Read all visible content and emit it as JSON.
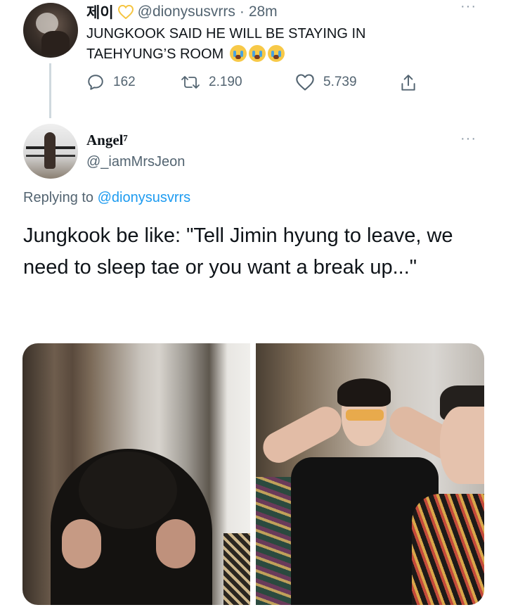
{
  "tweet": {
    "display_name": "제이",
    "handle": "@dionysusvrrs",
    "separator": "·",
    "time": "28m",
    "text": "JUNGKOOK SAID HE WILL BE STAYING IN TAEHYUNG’S ROOM",
    "emoji_count": 3,
    "emoji": "loudly-crying-face",
    "more_label": "···",
    "actions": {
      "reply_count": "162",
      "retweet_count": "2.190",
      "like_count": "5.739"
    },
    "badge_color": "#f5c542"
  },
  "reply": {
    "display_name": "Angel⁷",
    "handle": "@_iamMrsJeon",
    "more_label": "···",
    "replying_prefix": "Replying to",
    "replying_handle": "@dionysusvrrs",
    "text": "Jungkook be like: \"Tell Jimin hyung to leave, we need to sleep tae or you want a break up...\""
  },
  "colors": {
    "link": "#1d9bf0",
    "muted": "#536471",
    "thread_line": "#cfd9de"
  },
  "icons": [
    "reply-icon",
    "retweet-icon",
    "like-icon",
    "share-icon",
    "more-icon"
  ]
}
